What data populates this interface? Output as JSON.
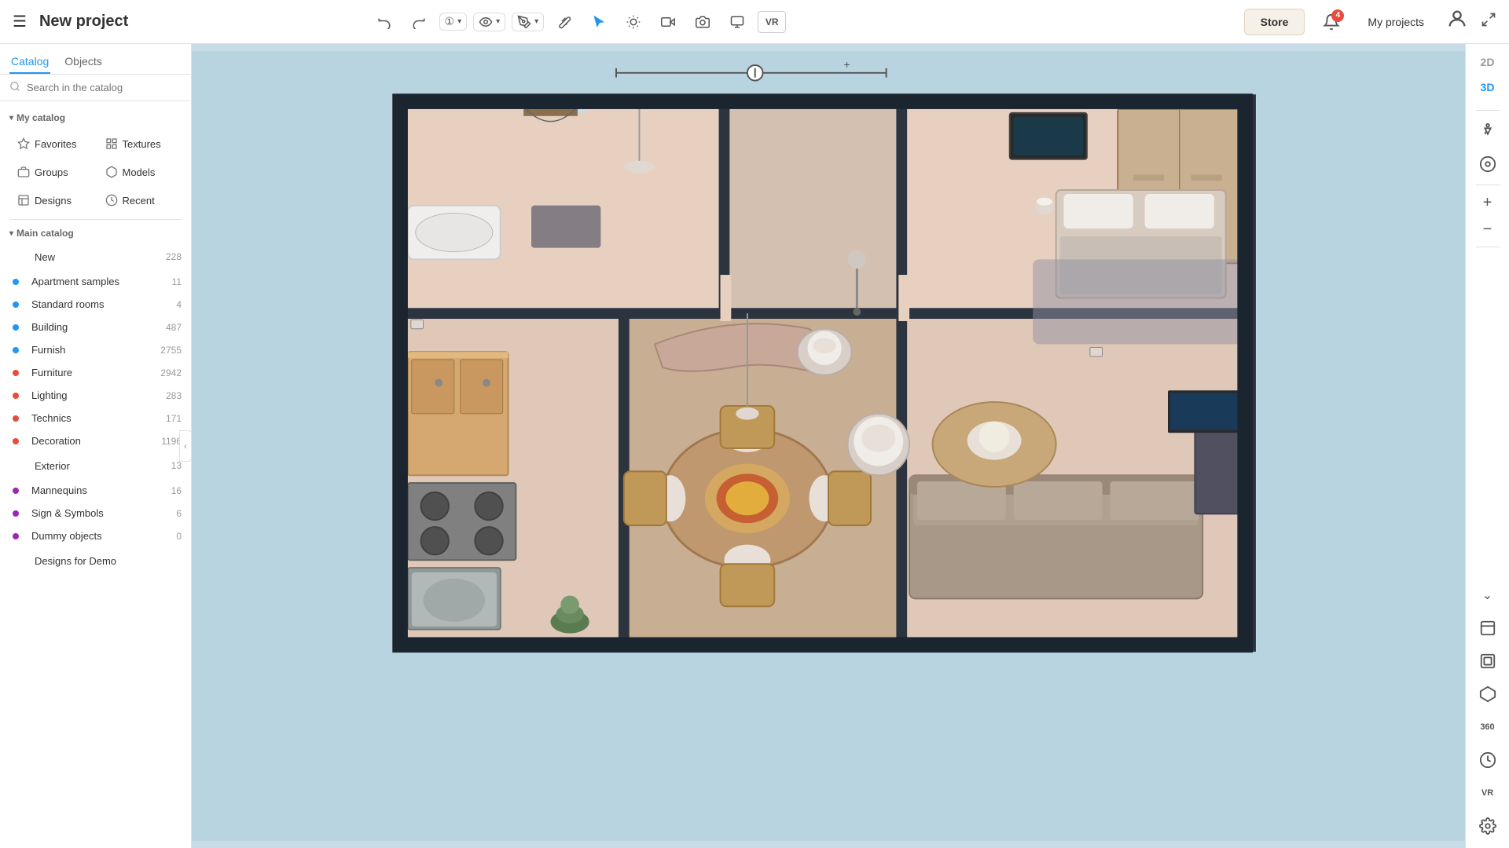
{
  "app": {
    "title": "New project",
    "menu_icon": "☰"
  },
  "header": {
    "undo_label": "↩",
    "redo_label": "↪",
    "step_label": "①",
    "eye_label": "👁",
    "tools_label": "🖊",
    "ruler_label": "📏",
    "cursor_label": "✎",
    "sun_label": "☀",
    "camera_label": "🎥",
    "photo_label": "📷",
    "floor_label": "⬜",
    "vr_label": "VR",
    "store_label": "Store",
    "notif_count": "4",
    "my_projects_label": "My projects",
    "account_label": "👤",
    "fullscreen_label": "⤢"
  },
  "sidebar": {
    "tab_catalog": "Catalog",
    "tab_objects": "Objects",
    "search_placeholder": "Search in the catalog",
    "my_catalog_label": "My catalog",
    "favorites_label": "Favorites",
    "textures_label": "Textures",
    "groups_label": "Groups",
    "models_label": "Models",
    "designs_label": "Designs",
    "recent_label": "Recent",
    "main_catalog_label": "Main catalog",
    "catalog_items": [
      {
        "name": "New",
        "count": 228,
        "dot_color": null
      },
      {
        "name": "Apartment samples",
        "count": 11,
        "dot_color": "#2196F3"
      },
      {
        "name": "Standard rooms",
        "count": 4,
        "dot_color": "#2196F3"
      },
      {
        "name": "Building",
        "count": 487,
        "dot_color": "#2196F3"
      },
      {
        "name": "Furnish",
        "count": 2755,
        "dot_color": "#2196F3"
      },
      {
        "name": "Furniture",
        "count": 2942,
        "dot_color": "#e74c3c"
      },
      {
        "name": "Lighting",
        "count": 283,
        "dot_color": "#e74c3c"
      },
      {
        "name": "Technics",
        "count": 171,
        "dot_color": "#e74c3c"
      },
      {
        "name": "Decoration",
        "count": 1196,
        "dot_color": "#e74c3c"
      },
      {
        "name": "Exterior",
        "count": 13,
        "dot_color": null
      },
      {
        "name": "Mannequins",
        "count": 16,
        "dot_color": "#9c27b0"
      },
      {
        "name": "Sign & Symbols",
        "count": 6,
        "dot_color": "#9c27b0"
      },
      {
        "name": "Dummy objects",
        "count": 0,
        "dot_color": "#9c27b0"
      },
      {
        "name": "Designs for Demo",
        "count": null,
        "dot_color": null
      }
    ]
  },
  "right_panel": {
    "view_2d": "2D",
    "view_3d": "3D",
    "walk_icon": "🚶",
    "compass_icon": "◎",
    "zoom_plus": "+",
    "zoom_minus": "−",
    "chevron_down": "⌄",
    "floor_icon": "▭",
    "layer_icon": "◫",
    "shape_icon": "◇",
    "deg360_icon": "360",
    "clock_icon": "◷",
    "vr_icon": "VR",
    "settings_icon": "⚙"
  },
  "colors": {
    "accent_blue": "#2196F3",
    "accent_red": "#e74c3c",
    "wall_dark": "#2c3e50",
    "floor_wood": "#8B5E3C",
    "floor_light": "#c9956e",
    "room_wall": "#e8d5c4",
    "bg_outside": "#b8d4e0"
  }
}
